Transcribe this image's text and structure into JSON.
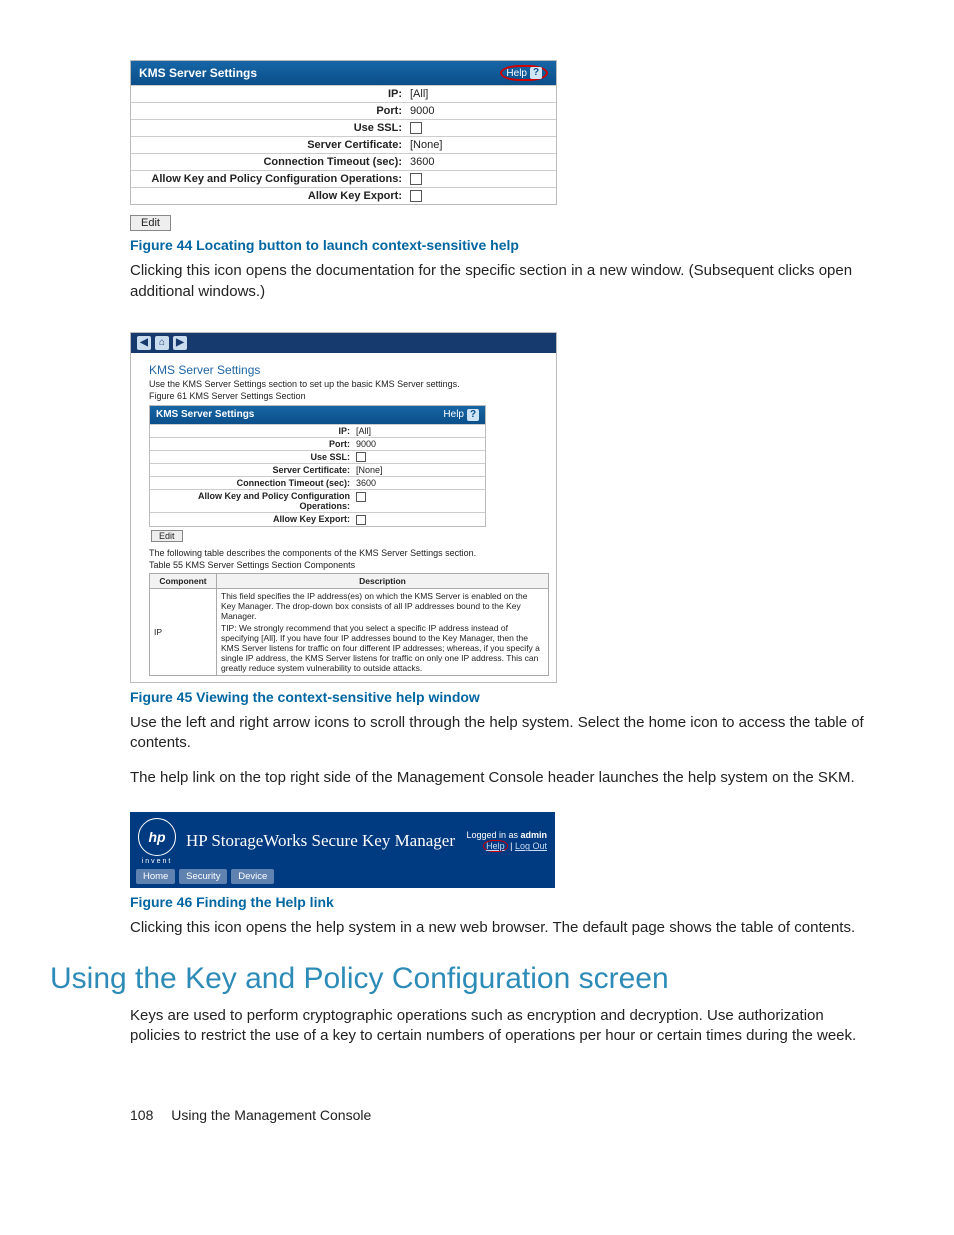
{
  "fig44": {
    "panel_title": "KMS Server Settings",
    "help_label": "Help",
    "rows": [
      {
        "label": "IP:",
        "value": "[All]"
      },
      {
        "label": "Port:",
        "value": "9000"
      },
      {
        "label": "Use SSL:",
        "checkbox": true
      },
      {
        "label": "Server Certificate:",
        "value": "[None]"
      },
      {
        "label": "Connection Timeout (sec):",
        "value": "3600"
      },
      {
        "label": "Allow Key and Policy Configuration Operations:",
        "checkbox": true
      },
      {
        "label": "Allow Key Export:",
        "checkbox": true
      }
    ],
    "edit_label": "Edit",
    "caption": "Figure 44 Locating button to launch context-sensitive help",
    "body": "Clicking this icon opens the documentation for the specific section in a new window. (Subsequent clicks open additional windows.)"
  },
  "fig45": {
    "nav_icons": [
      "◀",
      "⌂",
      "▶"
    ],
    "title": "KMS Server Settings",
    "subtitle": "Use the KMS Server Settings section to set up the basic KMS Server settings.",
    "fignum": "Figure 61 KMS Server Settings Section",
    "panel_title": "KMS Server Settings",
    "help_label": "Help",
    "rows": [
      {
        "label": "IP:",
        "value": "[All]"
      },
      {
        "label": "Port:",
        "value": "9000"
      },
      {
        "label": "Use SSL:",
        "checkbox": true
      },
      {
        "label": "Server Certificate:",
        "value": "[None]"
      },
      {
        "label": "Connection Timeout (sec):",
        "value": "3600"
      },
      {
        "label": "Allow Key and Policy Configuration Operations:",
        "checkbox": true
      },
      {
        "label": "Allow Key Export:",
        "checkbox": true
      }
    ],
    "edit_label": "Edit",
    "desc_line": "The following table describes the components of the KMS Server Settings section.",
    "table_caption": "Table 55 KMS Server Settings Section Components",
    "th1": "Component",
    "th2": "Description",
    "comp_name": "IP",
    "comp_desc_line1": "This field specifies the IP address(es) on which the KMS Server is enabled on the Key Manager. The drop-down box consists of all IP addresses bound to the Key Manager.",
    "comp_desc_line2": "TIP: We strongly recommend that you select a specific IP address instead of specifying [All]. If you have four IP addresses bound to the Key Manager, then the KMS Server listens for traffic on four different IP addresses; whereas, if you specify a single IP address, the KMS Server listens for traffic on only one IP address. This can greatly reduce system vulnerability to outside attacks.",
    "caption": "Figure 45 Viewing the context-sensitive help window",
    "body1": "Use the left and right arrow icons to scroll through the help system. Select the home icon to access the table of contents.",
    "body2": "The help link on the top right side of the Management Console header launches the help system on the SKM."
  },
  "fig46": {
    "logo_text": "hp",
    "invent": "invent",
    "product_title": "HP StorageWorks Secure Key Manager",
    "logged_prefix": "Logged in as ",
    "logged_user": "admin",
    "help_link": "Help",
    "sep": " | ",
    "logout_link": "Log Out",
    "tabs": [
      "Home",
      "Security",
      "Device"
    ],
    "caption": "Figure 46 Finding the Help link",
    "body": "Clicking this icon opens the help system in a new web browser. The default page shows the table of contents."
  },
  "section": {
    "heading": "Using the Key and Policy Configuration screen",
    "body": "Keys are used to perform cryptographic operations such as encryption and decryption. Use authorization policies to restrict the use of a key to certain numbers of operations per hour or certain times during the week."
  },
  "footer": {
    "page_number": "108",
    "section_title": "Using the Management Console"
  }
}
